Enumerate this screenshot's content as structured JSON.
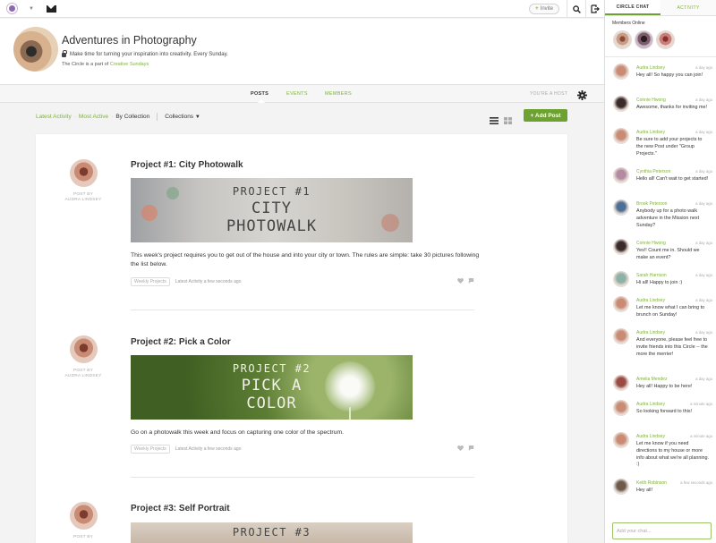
{
  "topbar": {
    "invite_label": "Invite",
    "icons": [
      "circle-logo-icon",
      "chevron-down-icon",
      "mail-icon",
      "search-icon",
      "logout-icon"
    ]
  },
  "circle": {
    "title": "Adventures in Photography",
    "tagline": "Make time for turning your inspiration into creativity. Every Sunday.",
    "part_of_prefix": "The Circle is a part of",
    "part_of_link": "Creative Sundays"
  },
  "tabs": {
    "posts": "POSTS",
    "events": "EVENTS",
    "members": "MEMBERS",
    "host_label": "YOU'RE A HOST"
  },
  "filters": {
    "latest": "Latest Activity",
    "most_active": "Most Active",
    "by_collection": "By Collection",
    "collections": "Collections",
    "add_post": "+ Add Post"
  },
  "posts": [
    {
      "title": "Project #1: City Photowalk",
      "by_label": "POST BY",
      "author": "AUDRA LINDSEY",
      "banner": [
        "PROJECT #1",
        "CITY",
        "PHOTOWALK"
      ],
      "desc": "This week's project requires you to get out of the house and into your city or town. The rules are simple: take 30 pictures following the list below.",
      "tag": "Weekly Projects",
      "activity": "Latest Activity a few seconds ago"
    },
    {
      "title": "Project #2: Pick a Color",
      "by_label": "POST BY",
      "author": "AUDRA LINDSEY",
      "banner": [
        "PROJECT #2",
        "PICK A",
        "COLOR"
      ],
      "desc": "Go on a photowalk this week and focus on capturing one color of the spectrum.",
      "tag": "Weekly Projects",
      "activity": "Latest Activity a few seconds ago"
    },
    {
      "title": "Project #3: Self Portrait",
      "by_label": "POST BY",
      "banner": [
        "PROJECT #3"
      ]
    }
  ],
  "rpanel": {
    "tab_chat": "CIRCLE CHAT",
    "tab_activity": "ACTIVITY",
    "members_online": "Members Online",
    "chat_placeholder": "Add your chat...",
    "messages": [
      {
        "name": "Audra Lindsey",
        "time": "a day ago",
        "text": "Hey all! So happy you can join!",
        "color": "#c98b73"
      },
      {
        "name": "Connie Hwong",
        "time": "a day ago",
        "text": "Awesome, thanks for inviting me!",
        "color": "#3a2a2a"
      },
      {
        "name": "Audra Lindsey",
        "time": "a day ago",
        "text": "Be sure to add your projects to the new Post under \"Group Projects.\"",
        "color": "#c98b73"
      },
      {
        "name": "Cynthia Peterson",
        "time": "a day ago",
        "text": "Hello all! Can't wait to get started!",
        "color": "#b48aa0"
      },
      {
        "name": "Brook Peterson",
        "time": "a day ago",
        "text": "Anybody up for a photo walk adventure in the Mission next Sunday?",
        "color": "#4e6f95"
      },
      {
        "name": "Connie Hwong",
        "time": "a day ago",
        "text": "Yes!! Count me in. Should we make an event?",
        "color": "#3a2a2a"
      },
      {
        "name": "Sarah Harrison",
        "time": "a day ago",
        "text": "Hi all! Happy to join :)",
        "color": "#8fb0a6"
      },
      {
        "name": "Audra Lindsey",
        "time": "a day ago",
        "text": "Let me know what I can bring to brunch on Sunday!",
        "color": "#c98b73"
      },
      {
        "name": "Audra Lindsey",
        "time": "a day ago",
        "text": "And everyone, please feel free to invite friends into this Circle -- the more the merrier!",
        "color": "#c98b73"
      },
      {
        "name": "Amelia Mendez",
        "time": "a day ago",
        "text": "Hey all! Happy to be here!",
        "color": "#9a4a42"
      },
      {
        "name": "Audra Lindsey",
        "time": "a minute ago",
        "text": "So looking forward to this!",
        "color": "#c98b73"
      },
      {
        "name": "Audra Lindsey",
        "time": "a minute ago",
        "text": "Let me know if you need directions to my house or more info about what we're all planning. :)",
        "color": "#c98b73"
      },
      {
        "name": "Keith Robinson",
        "time": "a few seconds ago",
        "text": "Hey all!",
        "color": "#6d5a4a"
      }
    ]
  },
  "colors": {
    "accent": "#7fb23a",
    "add_button": "#6da131"
  }
}
